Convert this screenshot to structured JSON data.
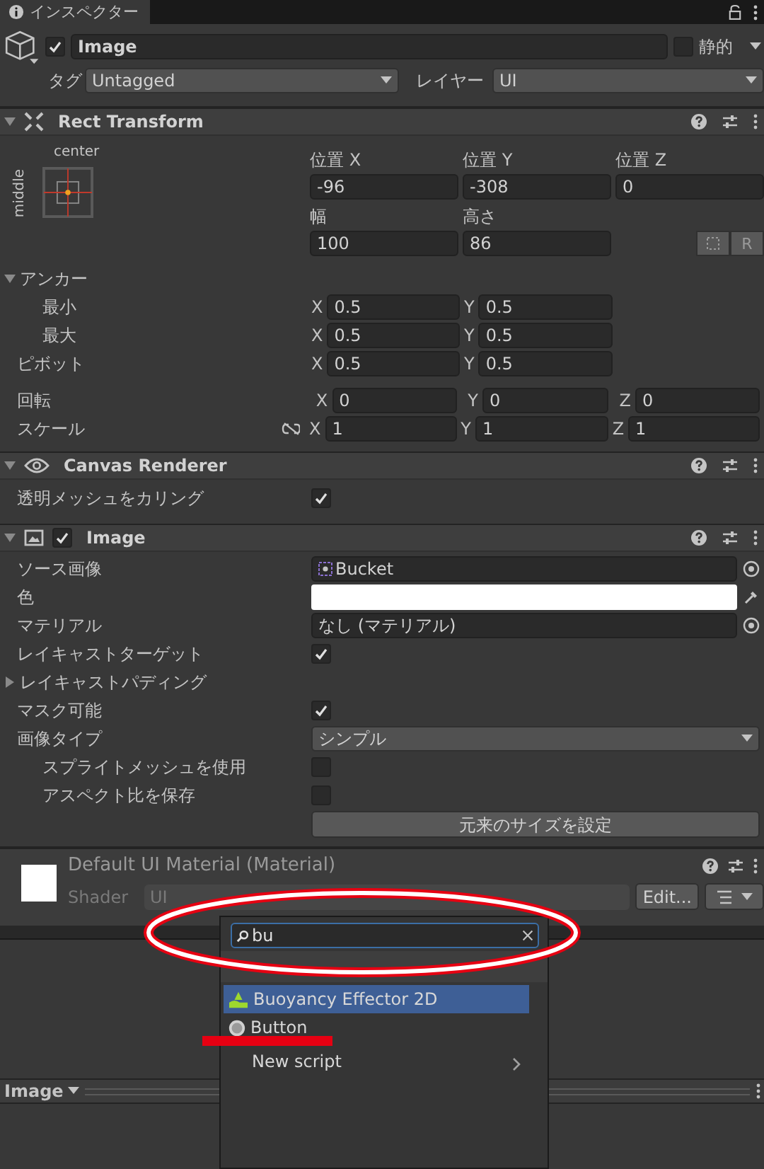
{
  "tab": {
    "title": "インスペクター"
  },
  "object": {
    "active": true,
    "name": "Image",
    "static": false,
    "static_label": "静的",
    "tag_label": "タグ",
    "tag": "Untagged",
    "layer_label": "レイヤー",
    "layer": "UI"
  },
  "rect_transform": {
    "title": "Rect Transform",
    "expanded": true,
    "anchor_h": "center",
    "anchor_v": "middle",
    "position": [
      {
        "label": "位置 X",
        "value": "-96"
      },
      {
        "label": "位置 Y",
        "value": "-308"
      },
      {
        "label": "位置 Z",
        "value": "0"
      }
    ],
    "size": [
      {
        "label": "幅",
        "value": "100"
      },
      {
        "label": "高さ",
        "value": "86"
      }
    ],
    "raw_button": "R",
    "anchors": {
      "label": "アンカー",
      "expanded": true,
      "children": [
        {
          "label": "最小",
          "fields": [
            {
              "axis": "X",
              "value": "0.5"
            },
            {
              "axis": "Y",
              "value": "0.5"
            }
          ]
        },
        {
          "label": "最大",
          "fields": [
            {
              "axis": "X",
              "value": "0.5"
            },
            {
              "axis": "Y",
              "value": "0.5"
            }
          ]
        }
      ]
    },
    "pivot": {
      "label": "ピボット",
      "fields": [
        {
          "axis": "X",
          "value": "0.5"
        },
        {
          "axis": "Y",
          "value": "0.5"
        }
      ]
    },
    "rotation": {
      "label": "回転",
      "fields": [
        {
          "axis": "X",
          "value": "0"
        },
        {
          "axis": "Y",
          "value": "0"
        },
        {
          "axis": "Z",
          "value": "0"
        }
      ]
    },
    "scale": {
      "label": "スケール",
      "fields": [
        {
          "axis": "X",
          "value": "1"
        },
        {
          "axis": "Y",
          "value": "1"
        },
        {
          "axis": "Z",
          "value": "1"
        }
      ]
    }
  },
  "canvas_renderer": {
    "title": "Canvas Renderer",
    "expanded": true,
    "properties": [
      {
        "kind": "checkbox",
        "label": "透明メッシュをカリング",
        "checked": true
      }
    ]
  },
  "image": {
    "title": "Image",
    "expanded": true,
    "enabled": true,
    "properties": [
      {
        "kind": "object",
        "label": "ソース画像",
        "value": "Bucket"
      },
      {
        "kind": "color",
        "label": "色",
        "color": "#ffffff"
      },
      {
        "kind": "object",
        "label": "マテリアル",
        "value": "なし (マテリアル)"
      },
      {
        "kind": "checkbox",
        "label": "レイキャストターゲット",
        "checked": true
      },
      {
        "kind": "foldout",
        "label": "レイキャストパディング",
        "expanded": false
      },
      {
        "kind": "checkbox",
        "label": "マスク可能",
        "checked": true
      },
      {
        "kind": "dropdown",
        "label": "画像タイプ",
        "value": "シンプル",
        "children": [
          {
            "kind": "checkbox",
            "label": "スプライトメッシュを使用",
            "checked": false
          },
          {
            "kind": "checkbox",
            "label": "アスペクト比を保存",
            "checked": false
          }
        ]
      },
      {
        "kind": "button",
        "label": "元来のサイズを設定"
      }
    ]
  },
  "material": {
    "title": "Default UI Material (Material)",
    "shader_label": "Shader",
    "shader": "UI",
    "edit_button": "Edit..."
  },
  "popup": {
    "query": "bu",
    "items": [
      {
        "kind": "component",
        "label": "Buoyancy Effector 2D",
        "selected": true
      },
      {
        "kind": "component",
        "label": "Button",
        "selected": false
      },
      {
        "kind": "submenu",
        "label": "New script",
        "selected": false
      }
    ]
  },
  "preview": {
    "title": "Image"
  }
}
